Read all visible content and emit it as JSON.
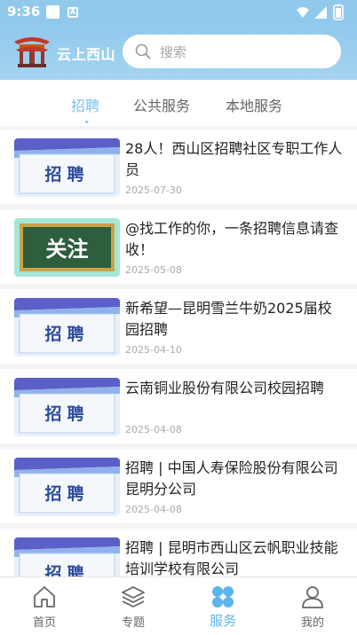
{
  "status_bar": {
    "time": "9:36",
    "notif_letter": "A"
  },
  "header": {
    "logo_text": "云上西山",
    "search_placeholder": "搜索"
  },
  "tabs": [
    {
      "label": "招聘",
      "active": true
    },
    {
      "label": "公共服务",
      "active": false
    },
    {
      "label": "本地服务",
      "active": false
    }
  ],
  "thumb_labels": {
    "recruit": "招聘",
    "follow": "关注"
  },
  "articles": [
    {
      "title": "28人！西山区招聘社区专职工作人员",
      "date": "2025-07-30",
      "thumb": "recruit"
    },
    {
      "title": "@找工作的你，一条招聘信息请查收！",
      "date": "2025-05-08",
      "thumb": "follow"
    },
    {
      "title": "新希望—昆明雪兰牛奶2025届校园招聘",
      "date": "2025-04-10",
      "thumb": "recruit"
    },
    {
      "title": "云南铜业股份有限公司校园招聘",
      "date": "2025-04-08",
      "thumb": "recruit"
    },
    {
      "title": "招聘 | 中国人寿保险股份有限公司昆明分公司",
      "date": "2025-04-08",
      "thumb": "recruit"
    },
    {
      "title": "招聘 | 昆明市西山区云帆职业技能培训学校有限公司",
      "date": "",
      "thumb": "recruit"
    }
  ],
  "bottom_nav": [
    {
      "label": "首页",
      "icon": "home-icon",
      "active": false
    },
    {
      "label": "专题",
      "icon": "layers-icon",
      "active": false
    },
    {
      "label": "服务",
      "icon": "service-icon",
      "active": true
    },
    {
      "label": "我的",
      "icon": "user-icon",
      "active": false
    }
  ],
  "colors": {
    "accent": "#7ec2ee",
    "header_bg": "#90c9ec",
    "active_nav": "#5bb5ea"
  }
}
